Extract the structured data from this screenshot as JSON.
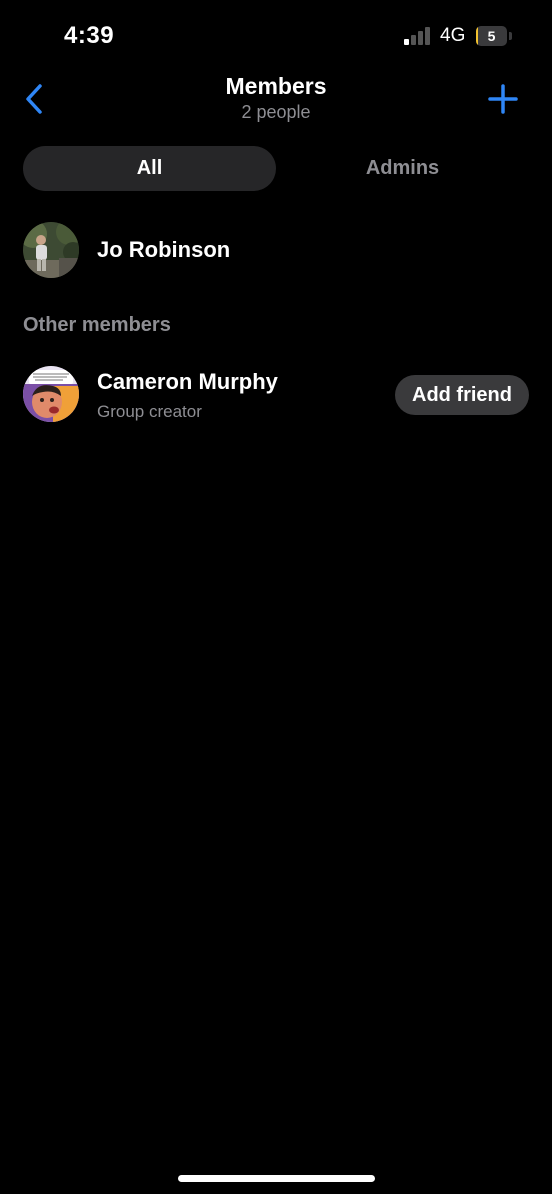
{
  "status_bar": {
    "time": "4:39",
    "network": "4G",
    "battery_level": "5",
    "signal_bars_active": 1,
    "signal_bars_total": 4,
    "battery_fraction": 0.05
  },
  "header": {
    "title": "Members",
    "subtitle": "2 people",
    "back_icon": "chevron-left-icon",
    "add_icon": "plus-icon"
  },
  "tabs": [
    {
      "label": "All",
      "selected": true
    },
    {
      "label": "Admins",
      "selected": false
    }
  ],
  "members": [
    {
      "name": "Jo Robinson"
    }
  ],
  "other_members": {
    "section_label": "Other members",
    "items": [
      {
        "name": "Cameron Murphy",
        "role": "Group creator",
        "action_label": "Add friend"
      }
    ]
  },
  "colors": {
    "accent": "#2f86f6",
    "background": "#000000",
    "secondary_text": "#8e8e93",
    "battery": "#f2c230"
  }
}
